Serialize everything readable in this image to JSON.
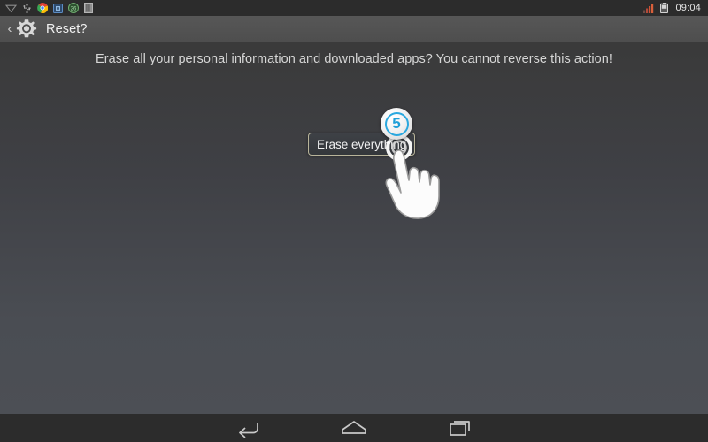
{
  "status_bar": {
    "icons": [
      {
        "name": "wifi-icon",
        "label": "wifi"
      },
      {
        "name": "usb-icon",
        "label": "usb"
      },
      {
        "name": "chrome-icon",
        "label": "browser"
      },
      {
        "name": "blue-app-icon",
        "label": "app"
      },
      {
        "name": "green-counter-icon",
        "label": "26"
      },
      {
        "name": "storage-icon",
        "label": "storage"
      }
    ],
    "signal_label": "signal",
    "battery_label": "battery",
    "clock": "09:04"
  },
  "action_bar": {
    "back_label": "‹",
    "icon": "settings-gear-icon",
    "title": "Reset?"
  },
  "content": {
    "warning_text": "Erase all your personal information and downloaded apps? You cannot reverse this action!",
    "erase_button_label": "Erase everything",
    "step_badge_number": "5"
  },
  "nav_bar": {
    "back_label": "Back",
    "home_label": "Home",
    "recents_label": "Recent apps"
  },
  "colors": {
    "accent_blue": "#1f9fd8",
    "status_bar_bg": "#2c2c2c",
    "action_bar_bg": "#535353",
    "button_border": "#b8b49a",
    "text_primary": "#f0f0f0",
    "text_secondary": "#d6d6d6"
  }
}
